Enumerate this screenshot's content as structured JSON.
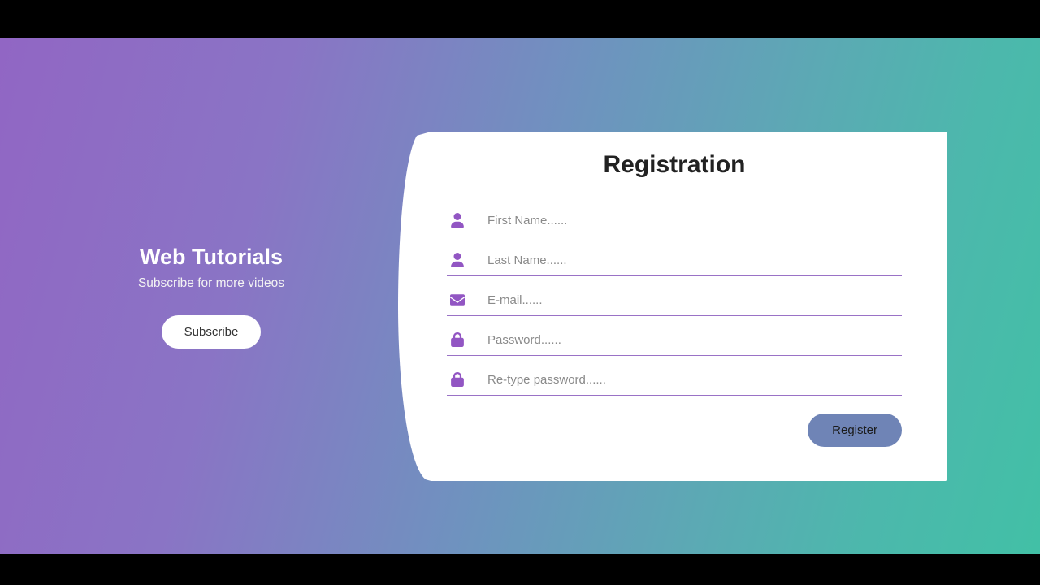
{
  "left": {
    "title": "Web Tutorials",
    "subtitle": "Subscribe for more videos",
    "subscribe": "Subscribe"
  },
  "form": {
    "title": "Registration",
    "firstName": {
      "placeholder": "First Name......"
    },
    "lastName": {
      "placeholder": "Last Name......"
    },
    "email": {
      "placeholder": "E-mail......"
    },
    "password": {
      "placeholder": "Password......"
    },
    "retype": {
      "placeholder": "Re-type password......"
    },
    "register": "Register"
  }
}
